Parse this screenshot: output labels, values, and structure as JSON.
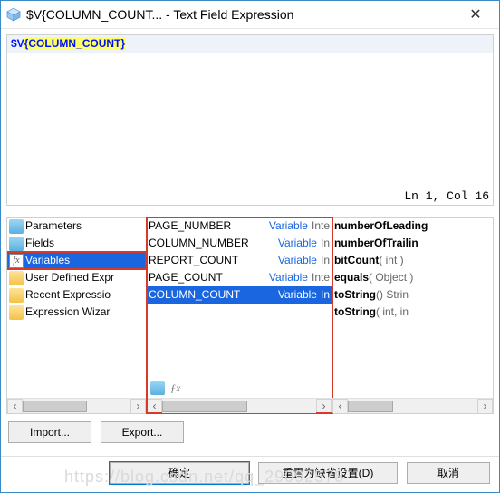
{
  "window": {
    "title": "$V{COLUMN_COUNT... - Text Field Expression",
    "close_glyph": "✕"
  },
  "editor": {
    "prefix": "$V",
    "brace_open": "{",
    "ident": "COLUMN_COUNT",
    "brace_close": "}",
    "status": "Ln 1, Col 16"
  },
  "tree": {
    "items": [
      {
        "icon": "db",
        "label": "Parameters",
        "selected": false
      },
      {
        "icon": "db",
        "label": "Fields",
        "selected": false
      },
      {
        "icon": "fx",
        "label": "Variables",
        "selected": true
      },
      {
        "icon": "folder",
        "label": "User Defined Expr",
        "selected": false
      },
      {
        "icon": "folder",
        "label": "Recent Expressio",
        "selected": false
      },
      {
        "icon": "folder",
        "label": "Expression Wizar",
        "selected": false
      }
    ]
  },
  "vars": {
    "items": [
      {
        "name": "PAGE_NUMBER",
        "kind": "Variable",
        "type": "Inte",
        "selected": false
      },
      {
        "name": "COLUMN_NUMBER",
        "kind": "Variable",
        "type": "In",
        "selected": false
      },
      {
        "name": "REPORT_COUNT",
        "kind": "Variable",
        "type": "In",
        "selected": false
      },
      {
        "name": "PAGE_COUNT",
        "kind": "Variable",
        "type": "Inte",
        "selected": false
      },
      {
        "name": "COLUMN_COUNT",
        "kind": "Variable",
        "type": "In",
        "selected": true
      }
    ]
  },
  "methods": {
    "items": [
      {
        "name": "numberOfLeading",
        "sig": ""
      },
      {
        "name": "numberOfTrailin",
        "sig": ""
      },
      {
        "name": "bitCount",
        "sig": "( int )"
      },
      {
        "name": "equals",
        "sig": "( Object )"
      },
      {
        "name": "toString",
        "sig": "() Strin"
      },
      {
        "name": "toString",
        "sig": "( int, in"
      }
    ]
  },
  "scroll_glyphs": {
    "left": "‹",
    "right": "›"
  },
  "mid_toolbar_fx": "ƒx",
  "io": {
    "import": "Import...",
    "export": "Export..."
  },
  "actions": {
    "ok": "确定",
    "reset": "重置为缺省设置(D)",
    "cancel": "取消"
  },
  "watermark": "https://blog.csdn.net/qq_29092578"
}
